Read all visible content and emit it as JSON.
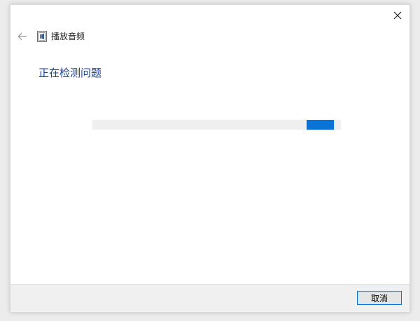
{
  "window": {
    "title": "播放音频",
    "heading": "正在检测问题"
  },
  "icons": {
    "close": "close-icon",
    "back": "back-arrow-icon",
    "app": "troubleshooter-app-icon"
  },
  "progress": {
    "indeterminate": true,
    "accent_color": "#0a74d6",
    "track_color": "#efefef"
  },
  "footer": {
    "cancel_label": "取消"
  }
}
